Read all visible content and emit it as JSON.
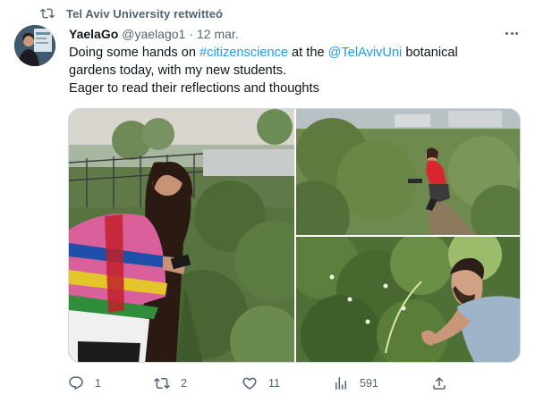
{
  "retweet": {
    "text": "Tel Aviv University retwitteó",
    "icon": "retweet-icon"
  },
  "tweet": {
    "author_name": "YaelaGo",
    "author_handle": "@yaelago1",
    "separator": "·",
    "date": "12 mar.",
    "text": {
      "line1_pre": "Doing some hands on ",
      "line1_hashtag": "#citizenscience",
      "line1_mid": " at the ",
      "line1_mention": "@TelAvivUni",
      "line1_post": " botanical",
      "line2": "gardens today, with my new students.",
      "line3": "Eager to read their reflections and thoughts"
    }
  },
  "media": [
    {
      "description_icon": "photo-student-with-phone-in-garden"
    },
    {
      "description_icon": "photo-student-crouching-in-garden"
    },
    {
      "description_icon": "photo-man-examining-plants"
    }
  ],
  "actions": {
    "reply": {
      "icon": "reply-icon",
      "count": "1"
    },
    "retweet": {
      "icon": "retweet-icon",
      "count": "2"
    },
    "like": {
      "icon": "heart-icon",
      "count": "11"
    },
    "views": {
      "icon": "views-icon",
      "count": "591"
    },
    "share": {
      "icon": "share-icon"
    }
  },
  "colors": {
    "link": "#1d9bf0",
    "secondary_text": "#536471",
    "primary_text": "#0f1419"
  }
}
